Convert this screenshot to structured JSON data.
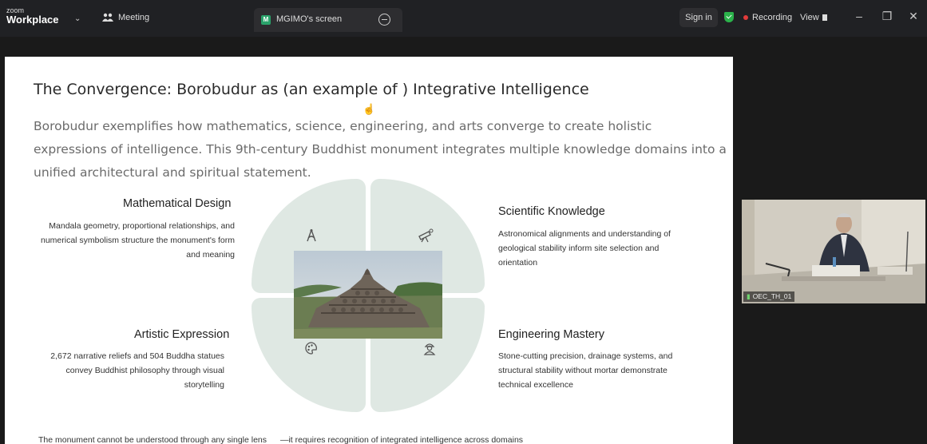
{
  "app": {
    "brand_top": "zoom",
    "brand_name": "Workplace",
    "meeting_label": "Meeting",
    "share_badge": "M",
    "share_tab_label": "MGIMO's screen",
    "sign_in": "Sign in",
    "recording": "Recording",
    "view": "View",
    "window_controls": {
      "minimize": "–",
      "restore": "❐",
      "close": "✕"
    }
  },
  "slide": {
    "title": "The Convergence: Borobudur as (an example of ) Integrative Intelligence",
    "intro": "Borobudur exemplifies how mathematics, science, engineering, and arts converge to create holistic expressions of intelligence. This 9th-century Buddhist monument integrates multiple knowledge domains into a unified architectural and spiritual statement.",
    "sections": {
      "math": {
        "heading": "Mathematical Design",
        "body": "Mandala geometry, proportional relationships, and numerical symbolism structure the monument's form and meaning",
        "icon": "compass-icon"
      },
      "science": {
        "heading": "Scientific Knowledge",
        "body": "Astronomical alignments and understanding of geological stability inform site selection and orientation",
        "icon": "telescope-icon"
      },
      "art": {
        "heading": "Artistic Expression",
        "body": "2,672 narrative reliefs and 504 Buddha statues convey Buddhist philosophy through visual storytelling",
        "icon": "palette-icon"
      },
      "eng": {
        "heading": "Engineering Mastery",
        "body": "Stone-cutting precision, drainage systems, and structural stability without mortar demonstrate technical excellence",
        "icon": "engineer-icon"
      }
    },
    "footer_left": "The monument cannot be understood through any single lens",
    "footer_right": "—it requires recognition of integrated intelligence across domains"
  },
  "video": {
    "participant": "OEC_TH_01"
  },
  "colors": {
    "background": "#1a1a1a",
    "topbar": "#202124",
    "slide": "#ffffff",
    "quadrant": "#dfe8e3",
    "recording_dot": "#e23b3b",
    "security_green": "#2bb34b"
  }
}
